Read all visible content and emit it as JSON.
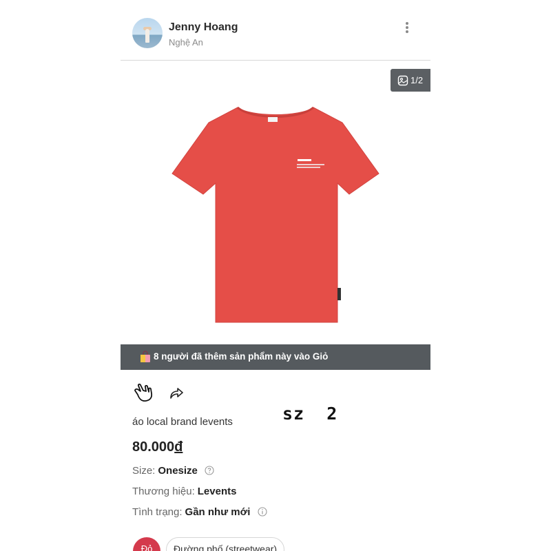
{
  "seller": {
    "name": "Jenny Hoang",
    "location": "Nghệ An"
  },
  "header": {
    "more_icon": "vertical-ellipsis-icon"
  },
  "gallery": {
    "counter": "1/2",
    "counter_icon": "gallery-icon",
    "image": "red-tshirt-levents",
    "image_color": "#e54e48"
  },
  "cart_banner": {
    "icon": "shopping-bag-icon",
    "text": "8 người đã thêm sản phẩm này vào Giỏ",
    "background": "#555a5e"
  },
  "actions": {
    "like_icon": "hand-love-icon",
    "share_icon": "share-arrow-icon"
  },
  "product": {
    "title": "áo local brand levents",
    "size_note": "sz  2",
    "price": "80.000",
    "currency": "đ",
    "attributes": [
      {
        "label": "Size:",
        "value": "Onesize",
        "icon": "question-circle-icon"
      },
      {
        "label": "Thương hiệu:",
        "value": "Levents"
      },
      {
        "label": "Tình trạng:",
        "value": "Gần như mới",
        "icon": "info-circle-icon"
      }
    ]
  },
  "tags": [
    {
      "label": "Đỏ",
      "color": "#d43a4c"
    },
    {
      "label": "Đường phố (streetwear)"
    }
  ]
}
